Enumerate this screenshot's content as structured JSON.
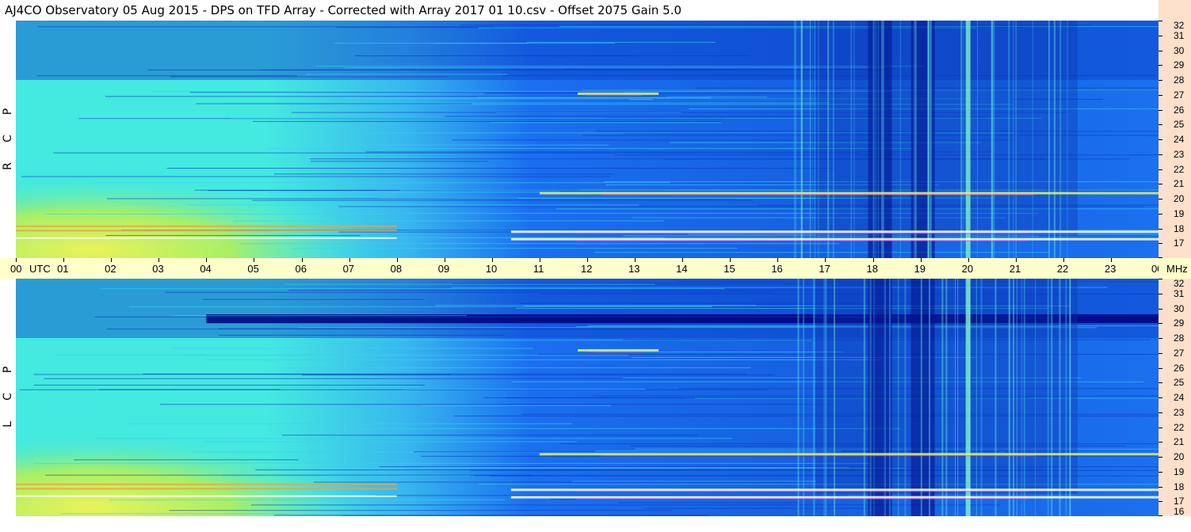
{
  "title": "AJ4CO Observatory  05 Aug 2015  -  DPS on TFD Array  -  Corrected with Array 2017 01 10.csv  -  Offset 2075  Gain 5.0",
  "chart_data": {
    "type": "heatmap",
    "title": "AJ4CO Observatory  05 Aug 2015  -  DPS on TFD Array  -  Corrected with Array 2017 01 10.csv  -  Offset 2075  Gain 5.0",
    "x_unit": "UTC",
    "y_unit": "MHz",
    "x_ticks": [
      "00",
      "01",
      "02",
      "03",
      "04",
      "05",
      "06",
      "07",
      "08",
      "09",
      "10",
      "11",
      "12",
      "13",
      "14",
      "15",
      "16",
      "17",
      "18",
      "19",
      "20",
      "21",
      "22",
      "23",
      "00"
    ],
    "xlim": [
      0,
      24
    ],
    "ylim": [
      16,
      32
    ],
    "y_ticks": [
      "32",
      "31",
      "30",
      "29",
      "28",
      "27",
      "26",
      "25",
      "24",
      "23",
      "22",
      "21",
      "20",
      "19",
      "18",
      "17",
      "16"
    ],
    "colors": {
      "low": "#00007a",
      "mid": "#1a6ff0",
      "high": "#44e9e0",
      "hot": "#e9f25a",
      "peak": "#ffffff",
      "spike": "#e040e0"
    },
    "panels": [
      {
        "name": "RCP",
        "label_letters": [
          "P",
          "C",
          "R"
        ],
        "features": {
          "day_background_hours": [
            0,
            9
          ],
          "dark_vertical_band_hours": [
            [
              17.9,
              18.4
            ],
            [
              18.8,
              19.3
            ]
          ],
          "bright_vertical_line_hours": [
            19.95,
            20.05
          ],
          "horizontal_bright_bands_mhz": [
            17.3,
            17.8,
            20.4,
            27.1
          ]
        }
      },
      {
        "name": "LCP",
        "label_letters": [
          "P",
          "C",
          "L"
        ],
        "features": {
          "day_background_hours": [
            0,
            9
          ],
          "dark_vertical_band_hours": [
            [
              17.9,
              18.4
            ],
            [
              18.8,
              19.3
            ]
          ],
          "bright_vertical_line_hours": [
            19.95,
            20.05
          ],
          "dark_horizontal_band_mhz": [
            29.0,
            29.6
          ],
          "horizontal_bright_bands_mhz": [
            17.3,
            17.8,
            20.2,
            27.2
          ]
        }
      }
    ]
  }
}
